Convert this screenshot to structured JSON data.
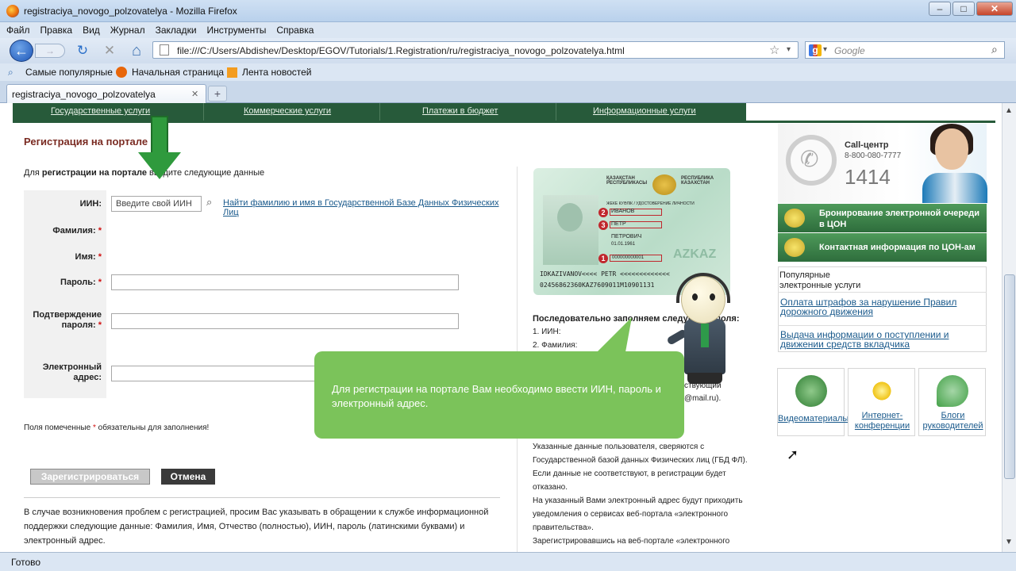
{
  "window": {
    "title": "registraciya_novogo_polzovatelya - Mozilla Firefox",
    "minimize": "–",
    "maximize": "□",
    "close": "✕"
  },
  "menu": [
    "Файл",
    "Правка",
    "Вид",
    "Журнал",
    "Закладки",
    "Инструменты",
    "Справка"
  ],
  "nav": {
    "url": "file:///C:/Users/Abdishev/Desktop/EGOV/Tutorials/1.Registration/ru/registraciya_novogo_polzovatelya.html",
    "search_placeholder": "Google",
    "back_icon": "←",
    "forward_icon": "→",
    "reload_icon": "↻",
    "stop_icon": "✕",
    "home_icon": "⌂",
    "star_icon": "☆",
    "dropdown_icon": "▾",
    "search_icon": "⌕"
  },
  "bookmarks": [
    "Самые популярные",
    "Начальная страница",
    "Лента новостей"
  ],
  "tab": {
    "label": "registraciya_novogo_polzovatelya",
    "close": "✕",
    "new_tab": "+"
  },
  "site_nav": [
    "Государственные услуги",
    "Коммерческие услуги",
    "Платежи в бюджет",
    "Информационные услуги"
  ],
  "form": {
    "heading": "Регистрация на портале",
    "intro_pre": "Для ",
    "intro_bold": "регистрации на портале",
    "intro_post": " введите следующие данные",
    "iin_label": "ИИН:",
    "iin_placeholder": "Введите свой ИИН",
    "find_link": "Найти фамилию и имя в Государственной Базе Данных Физических Лиц",
    "surname_label": "Фамилия:",
    "name_label": "Имя:",
    "password_label": "Пароль:",
    "confirm_label_1": "Подтверждение",
    "confirm_label_2": "пароля:",
    "email_label_1": "Электронный",
    "email_label_2": "адрес:",
    "required_mark": "*",
    "required_pre": "Поля помеченные ",
    "required_post": " обязательны для заполнения!",
    "register_button": "Зарегистрироваться",
    "cancel_button": "Отмена",
    "help_line1": "В случае возникновения проблем с регистрацией, просим Вас указывать в обращении к службе информационной",
    "help_line2": "поддержки следующие данные: Фамилия, Имя, Отчество (полностью), ИИН, пароль (латинскими буквами) и",
    "help_line3": "электронный адрес."
  },
  "idcard": {
    "header_left": "ҚАЗАҚСТАН РЕСПУБЛИКАСЫ",
    "header_right": "РЕСПУБЛИКА КАЗАХСТАН",
    "doc_line": "ЖЕКЕ КУӘЛІК / УДОСТОВЕРЕНИЕ ЛИЧНОСТИ",
    "surname": "ИВАНОВ",
    "name": "ПЕТР",
    "patronymic": "ПЕТРОВИЧ",
    "birth": "01.01.1961",
    "iin": "000000000001",
    "mrz1": "IDKAZIVANOV<<<< PETR <<<<<<<<<<<<<",
    "mrz2": "02456862360KAZ7609011M10901131",
    "watermark": "AZKAZ",
    "num1": "1",
    "num2": "2",
    "num3": "3"
  },
  "right_text": {
    "fill_title": "Последовательно заполняем следующие поля:",
    "step1": "1. ИИН:",
    "step2": "2. Фамилия:",
    "snippet1": "ствующий",
    "snippet2": "@mail.ru).",
    "p1": "Указанные данные пользователя, сверяются с",
    "p2": "Государственной базой данных Физических лиц (ГБД ФЛ).",
    "p3": "Если данные не соответствуют, в регистрации будет",
    "p4": "отказано.",
    "p5": "На указанный Вами электронный адрес будут приходить",
    "p6": "уведомления о сервисах веб-портала «электронного",
    "p7": "правительства».",
    "p8": "Зарегистрировавшись на веб-портале «электронного"
  },
  "tooltip": {
    "text": "Для регистрации на портале Вам необходимо ввести ИИН, пароль и электронный адрес."
  },
  "sidebar": {
    "call_title": "Call-центр",
    "call_phone": "8-800-080-7777",
    "call_number": "1414",
    "booking_line1": "Бронирование электронной очереди",
    "booking_line2": "в ЦОН",
    "contact": "Контактная информация по ЦОН-ам",
    "popular_line1": "Популярные",
    "popular_line2": "электронные услуги",
    "link1_line1": "Оплата штрафов за нарушение Правил",
    "link1_line2": "дорожного движения",
    "link2_line1": "Выдача информации о поступлении и",
    "link2_line2": "движении средств вкладчика",
    "tile1": "Видеоматериалы",
    "tile2_line1": "Интернет-",
    "tile2_line2": "конференции",
    "tile3_line1": "Блоги",
    "tile3_line2": "руководителей"
  },
  "status": {
    "text": "Готово"
  },
  "colors": {
    "site_green": "#275a3a",
    "heading_red": "#7a2b22",
    "tooltip_green": "#7bc35a",
    "link_blue": "#1a5a8c"
  }
}
